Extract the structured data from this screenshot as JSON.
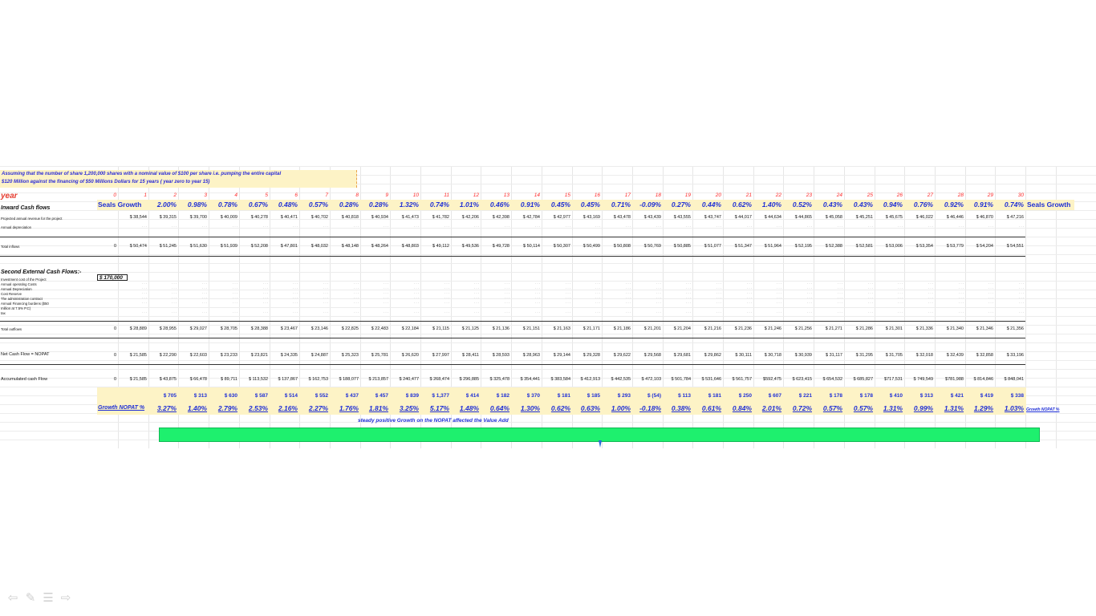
{
  "assumption": {
    "line1": "Assuming that the number of share 1,200,000 shares with a nominal value of $100 per share  i.e. pumping the entire capital",
    "line2": "$120 Million against the financing of $50 Millions Dollars for 15  years ( year zero to year 15)"
  },
  "year_label": "year",
  "years": [
    "0",
    "1",
    "2",
    "3",
    "4",
    "5",
    "6",
    "7",
    "8",
    "9",
    "10",
    "11",
    "12",
    "13",
    "14",
    "15",
    "16",
    "17",
    "18",
    "19",
    "20",
    "21",
    "22",
    "23",
    "24",
    "25",
    "26",
    "27",
    "28",
    "29",
    "30"
  ],
  "seals_growth_label": "Seals Growth",
  "seals_growth_pct": [
    "2.00%",
    "0.98%",
    "0.78%",
    "0.67%",
    "0.48%",
    "0.57%",
    "0.28%",
    "0.28%",
    "1.32%",
    "0.74%",
    "1.01%",
    "0.46%",
    "0.91%",
    "0.45%",
    "0.45%",
    "0.71%",
    "-0.09%",
    "0.27%",
    "0.44%",
    "0.62%",
    "1.40%",
    "0.52%",
    "0.43%",
    "0.43%",
    "0.94%",
    "0.76%",
    "0.92%",
    "0.91%",
    "0.74%"
  ],
  "sections": {
    "inward": "Inward Cash flows",
    "second": "Second External Cash Flows:-"
  },
  "labels": {
    "projected": "Projected annual revenue for the project",
    "depreciation_in": "Annual depreciation",
    "total_inflows": "Total inflows",
    "investment": "Investment cost of the Project",
    "op_costs": "Annual operating Costs",
    "depreciation_out": "Annual Depreciation",
    "cost_reserve": "Cost Reserve",
    "admin": "The administration contract",
    "financing": "Annual Financing burdens ($50",
    "financing2": "million at 7.5% P.C)",
    "tax": "tax",
    "total_outflows": "Total outflows",
    "net_cash_flow": "Net Cash Flow = NOPAT",
    "accumulated": "Accumulated cash Flow"
  },
  "investment_value": "$ 170,000",
  "projected_revenue": [
    "$ 38,544",
    "$ 39,315",
    "$ 39,700",
    "$ 40,009",
    "$ 40,278",
    "$ 40,471",
    "$ 40,702",
    "$ 40,818",
    "$ 40,934",
    "$ 41,473",
    "$ 41,782",
    "$ 42,206",
    "$ 42,398",
    "$ 42,784",
    "$ 42,977",
    "$ 43,169",
    "$ 43,478",
    "$ 43,439",
    "$ 43,555",
    "$ 43,747",
    "$ 44,017",
    "$ 44,634",
    "$ 44,865",
    "$ 45,058",
    "$ 45,251",
    "$ 45,675",
    "$ 46,022",
    "$ 46,446",
    "$ 46,870",
    "$ 47,216"
  ],
  "total_inflows": [
    "0",
    "$ 50,474",
    "$ 51,245",
    "$ 51,630",
    "$ 51,939",
    "$ 52,208",
    "$ 47,801",
    "$ 48,032",
    "$ 48,148",
    "$ 48,264",
    "$ 48,803",
    "$ 49,112",
    "$ 49,536",
    "$ 49,728",
    "$ 50,114",
    "$ 50,307",
    "$ 50,499",
    "$ 50,808",
    "$ 50,769",
    "$ 50,885",
    "$ 51,077",
    "$ 51,347",
    "$ 51,964",
    "$ 52,195",
    "$ 52,388",
    "$ 52,581",
    "$ 53,006",
    "$ 53,354",
    "$ 53,779",
    "$ 54,204",
    "$ 54,551"
  ],
  "total_outflows": [
    "0",
    "$ 28,889",
    "$ 28,955",
    "$ 29,027",
    "$ 28,705",
    "$ 28,388",
    "$ 23,467",
    "$ 23,146",
    "$ 22,825",
    "$ 22,483",
    "$ 22,184",
    "$ 21,115",
    "$ 21,125",
    "$ 21,136",
    "$ 21,151",
    "$ 21,163",
    "$ 21,171",
    "$ 21,186",
    "$ 21,201",
    "$ 21,204",
    "$ 21,216",
    "$ 21,236",
    "$ 21,246",
    "$ 21,256",
    "$ 21,271",
    "$ 21,286",
    "$ 21,301",
    "$ 21,336",
    "$ 21,340",
    "$ 21,346",
    "$ 21,356"
  ],
  "net_cash_flow": [
    "0",
    "$ 21,585",
    "$ 22,290",
    "$ 22,603",
    "$ 23,233",
    "$ 23,821",
    "$ 24,335",
    "$ 24,887",
    "$ 25,323",
    "$ 25,781",
    "$ 26,620",
    "$ 27,997",
    "$ 28,411",
    "$ 28,593",
    "$ 28,963",
    "$ 29,144",
    "$ 29,328",
    "$ 29,622",
    "$ 29,568",
    "$ 29,681",
    "$ 29,862",
    "$ 30,111",
    "$ 30,718",
    "$ 30,939",
    "$ 31,117",
    "$ 31,295",
    "$ 31,705",
    "$ 32,018",
    "$ 32,439",
    "$ 32,858",
    "$ 33,196"
  ],
  "accumulated": [
    "0",
    "$ 21,585",
    "$ 43,875",
    "$ 66,478",
    "$ 89,711",
    "$ 113,532",
    "$ 137,867",
    "$ 162,753",
    "$ 188,077",
    "$ 213,857",
    "$ 240,477",
    "$ 268,474",
    "$ 296,885",
    "$ 325,478",
    "$ 354,441",
    "$ 383,584",
    "$ 412,913",
    "$ 442,535",
    "$ 472,103",
    "$ 501,784",
    "$ 531,646",
    "$ 561,757",
    "$592,475",
    "$ 623,415",
    "$ 654,532",
    "$ 685,827",
    "$717,531",
    "$ 749,549",
    "$781,988",
    "$ 814,846",
    "$ 848,041"
  ],
  "nopat_delta": [
    "$ 705",
    "$ 313",
    "$ 630",
    "$ 587",
    "$ 514",
    "$ 552",
    "$ 437",
    "$ 457",
    "$ 839",
    "$ 1,377",
    "$ 414",
    "$ 182",
    "$ 370",
    "$ 181",
    "$ 185",
    "$ 293",
    "$ (54)",
    "$ 113",
    "$ 181",
    "$ 250",
    "$ 607",
    "$ 221",
    "$ 178",
    "$ 178",
    "$ 410",
    "$ 313",
    "$ 421",
    "$ 419",
    "$ 338"
  ],
  "growth_nopat_label": "Growth NOPAT %",
  "growth_nopat_pct": [
    "3.27%",
    "1.40%",
    "2.79%",
    "2.53%",
    "2.16%",
    "2.27%",
    "1.76%",
    "1.81%",
    "3.25%",
    "5.17%",
    "1.48%",
    "0.64%",
    "1.30%",
    "0.62%",
    "0.63%",
    "1.00%",
    "-0.18%",
    "0.38%",
    "0.61%",
    "0.84%",
    "2.01%",
    "0.72%",
    "0.57%",
    "0.57%",
    "1.31%",
    "0.99%",
    "1.31%",
    "1.29%",
    "1.03%"
  ],
  "growth_nopat_right": "Growth NOPAT %",
  "note": "steady positive Growth on the NOPAT affected  the Value Add",
  "nav": [
    "back-arrow-icon",
    "pen-icon",
    "menu-icon",
    "forward-arrow-icon"
  ]
}
